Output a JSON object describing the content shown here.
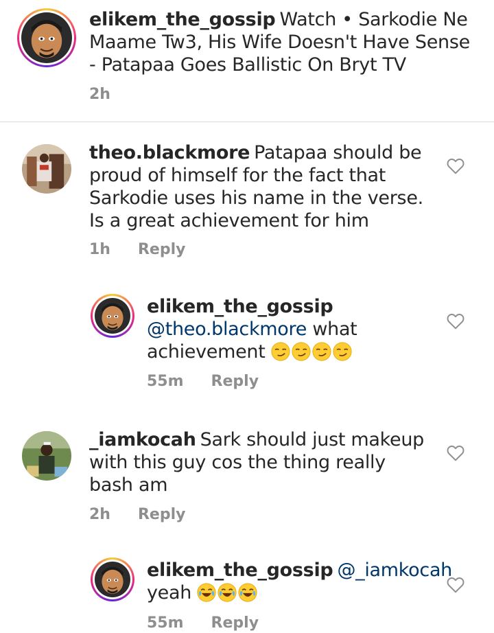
{
  "caption": {
    "username": "elikem_the_gossip",
    "text": "Watch • Sarkodie Ne Maame Tw3, His Wife Doesn't Have Sense - Patapaa Goes Ballistic On Bryt TV",
    "time": "2h"
  },
  "comments": [
    {
      "username": "theo.blackmore",
      "text": "Patapaa should be proud of himself for the fact that Sarkodie uses his name in the verse. Is a great achievement for him",
      "time": "1h",
      "reply_label": "Reply"
    },
    {
      "username": "elikem_the_gossip",
      "mention": "@theo.blackmore",
      "text": "what achievement",
      "emoji": "smirking-face",
      "emoji_count": 4,
      "time": "55m",
      "reply_label": "Reply"
    },
    {
      "username": "_iamkocah",
      "text": "Sark should just makeup with this guy cos the thing really bash am",
      "time": "2h",
      "reply_label": "Reply"
    },
    {
      "username": "elikem_the_gossip",
      "mention": "@_iamkocah",
      "text": "yeah",
      "emoji": "face-with-tears-of-joy",
      "emoji_count": 3,
      "time": "55m",
      "reply_label": "Reply"
    }
  ],
  "colors": {
    "text": "#262626",
    "meta": "#8e8e8e",
    "mention": "#00376b",
    "divider": "#dbdbdb"
  },
  "icons": [
    "heart-outline-icon",
    "avatar-story-ring"
  ]
}
